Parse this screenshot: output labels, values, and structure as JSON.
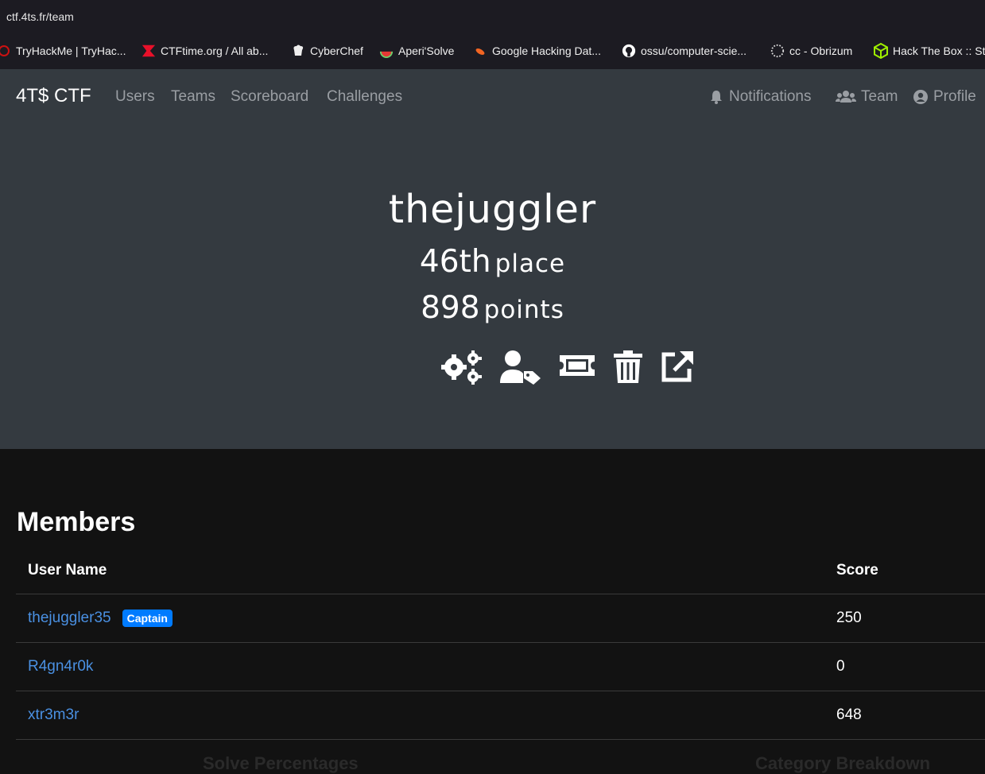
{
  "browser": {
    "url": "ctf.4ts.fr/team",
    "bookmarks": [
      {
        "label": "TryHackMe | TryHac...",
        "icon": "tryhackme-icon"
      },
      {
        "label": "CTFtime.org / All ab...",
        "icon": "ctftime-icon"
      },
      {
        "label": "CyberChef",
        "icon": "cyberchef-icon"
      },
      {
        "label": "Aperi'Solve",
        "icon": "aperisolve-icon"
      },
      {
        "label": "Google Hacking Dat...",
        "icon": "exploitdb-icon"
      },
      {
        "label": "ossu/computer-scie...",
        "icon": "github-icon"
      },
      {
        "label": "cc - Obrizum",
        "icon": "obrizum-icon"
      },
      {
        "label": "Hack The Box :: St",
        "icon": "hackthebox-icon"
      }
    ]
  },
  "navbar": {
    "brand": "4T$ CTF",
    "links": [
      "Users",
      "Teams",
      "Scoreboard",
      "Challenges"
    ],
    "right": [
      {
        "label": "Notifications",
        "icon": "bell-icon"
      },
      {
        "label": "Team",
        "icon": "users-icon"
      },
      {
        "label": "Profile",
        "icon": "user-circle-icon"
      }
    ]
  },
  "team": {
    "name": "thejuggler",
    "place_value": "46th",
    "place_label": "place",
    "points_value": "898",
    "points_label": "points",
    "actions": [
      "settings-icon",
      "user-tag-icon",
      "ticket-icon",
      "trash-icon",
      "external-link-icon"
    ]
  },
  "members": {
    "title": "Members",
    "columns": {
      "name": "User Name",
      "score": "Score"
    },
    "rows": [
      {
        "name": "thejuggler35",
        "badge": "Captain",
        "score": "250"
      },
      {
        "name": "R4gn4r0k",
        "badge": "",
        "score": "0"
      },
      {
        "name": "xtr3m3r",
        "badge": "",
        "score": "648"
      }
    ]
  },
  "footer_sections": {
    "left": "Solve Percentages",
    "right": "Category Breakdown"
  },
  "colors": {
    "navbar_bg": "#343a40",
    "page_bg": "#121212",
    "link": "#4a90e2",
    "badge": "#007bff"
  }
}
